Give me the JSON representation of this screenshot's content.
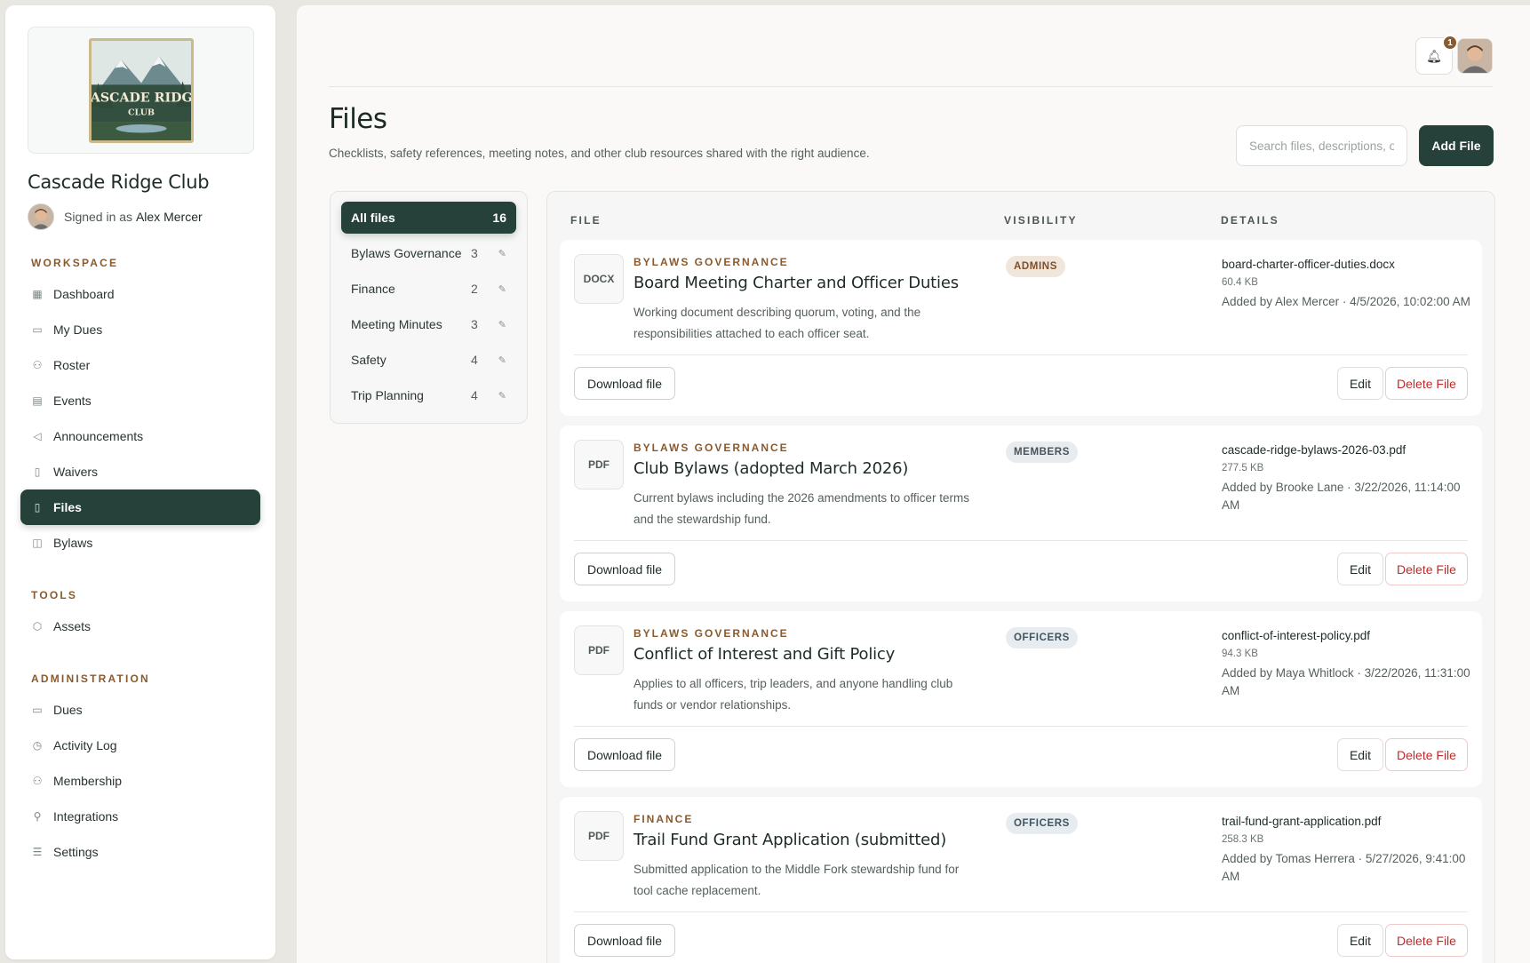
{
  "club": {
    "name": "Cascade Ridge Club",
    "logo_text": "CASCADE RIDGE",
    "logo_sub": "CLUB"
  },
  "user": {
    "signed_in_prefix": "Signed in as",
    "name": "Alex Mercer"
  },
  "nav": {
    "workspace_label": "WORKSPACE",
    "workspace": [
      {
        "label": "Dashboard",
        "icon": "grid-icon"
      },
      {
        "label": "My Dues",
        "icon": "card-icon"
      },
      {
        "label": "Roster",
        "icon": "people-icon"
      },
      {
        "label": "Events",
        "icon": "calendar-icon"
      },
      {
        "label": "Announcements",
        "icon": "megaphone-icon"
      },
      {
        "label": "Waivers",
        "icon": "document-icon"
      },
      {
        "label": "Files",
        "icon": "file-icon",
        "active": true
      },
      {
        "label": "Bylaws",
        "icon": "book-icon"
      }
    ],
    "tools_label": "TOOLS",
    "tools": [
      {
        "label": "Assets",
        "icon": "box-icon"
      }
    ],
    "admin_label": "ADMINISTRATION",
    "admin": [
      {
        "label": "Dues",
        "icon": "card-icon"
      },
      {
        "label": "Activity Log",
        "icon": "clock-icon"
      },
      {
        "label": "Membership",
        "icon": "people-icon"
      },
      {
        "label": "Integrations",
        "icon": "integration-icon"
      },
      {
        "label": "Settings",
        "icon": "sliders-icon"
      }
    ]
  },
  "header": {
    "notification_count": "1"
  },
  "page": {
    "title": "Files",
    "subtitle": "Checklists, safety references, meeting notes, and other club resources shared with the right audience.",
    "search_placeholder": "Search files, descriptions, or",
    "add_button": "Add File"
  },
  "categories": [
    {
      "name": "All files",
      "count": "16",
      "active": true
    },
    {
      "name": "Bylaws Governance",
      "count": "3"
    },
    {
      "name": "Finance",
      "count": "2"
    },
    {
      "name": "Meeting Minutes",
      "count": "3"
    },
    {
      "name": "Safety",
      "count": "4"
    },
    {
      "name": "Trip Planning",
      "count": "4"
    }
  ],
  "columns": {
    "file": "FILE",
    "visibility": "VISIBILITY",
    "details": "DETAILS"
  },
  "files": [
    {
      "type": "DOCX",
      "category": "BYLAWS GOVERNANCE",
      "title": "Board Meeting Charter and Officer Duties",
      "description": "Working document describing quorum, voting, and the responsibilities attached to each officer seat.",
      "visibility": "ADMINS",
      "visibility_class": "admins",
      "filename": "board-charter-officer-duties.docx",
      "size": "60.4 KB",
      "added": "Added by Alex Mercer · 4/5/2026, 10:02:00 AM"
    },
    {
      "type": "PDF",
      "category": "BYLAWS GOVERNANCE",
      "title": "Club Bylaws (adopted March 2026)",
      "description": "Current bylaws including the 2026 amendments to officer terms and the stewardship fund.",
      "visibility": "MEMBERS",
      "visibility_class": "members",
      "filename": "cascade-ridge-bylaws-2026-03.pdf",
      "size": "277.5 KB",
      "added": "Added by Brooke Lane · 3/22/2026, 11:14:00 AM"
    },
    {
      "type": "PDF",
      "category": "BYLAWS GOVERNANCE",
      "title": "Conflict of Interest and Gift Policy",
      "description": "Applies to all officers, trip leaders, and anyone handling club funds or vendor relationships.",
      "visibility": "OFFICERS",
      "visibility_class": "officers",
      "filename": "conflict-of-interest-policy.pdf",
      "size": "94.3 KB",
      "added": "Added by Maya Whitlock · 3/22/2026, 11:31:00 AM"
    },
    {
      "type": "PDF",
      "category": "FINANCE",
      "title": "Trail Fund Grant Application (submitted)",
      "description": "Submitted application to the Middle Fork stewardship fund for tool cache replacement.",
      "visibility": "OFFICERS",
      "visibility_class": "officers",
      "filename": "trail-fund-grant-application.pdf",
      "size": "258.3 KB",
      "added": "Added by Tomas Herrera · 5/27/2026, 9:41:00 AM"
    }
  ],
  "actions": {
    "download": "Download file",
    "edit": "Edit",
    "delete": "Delete File"
  }
}
